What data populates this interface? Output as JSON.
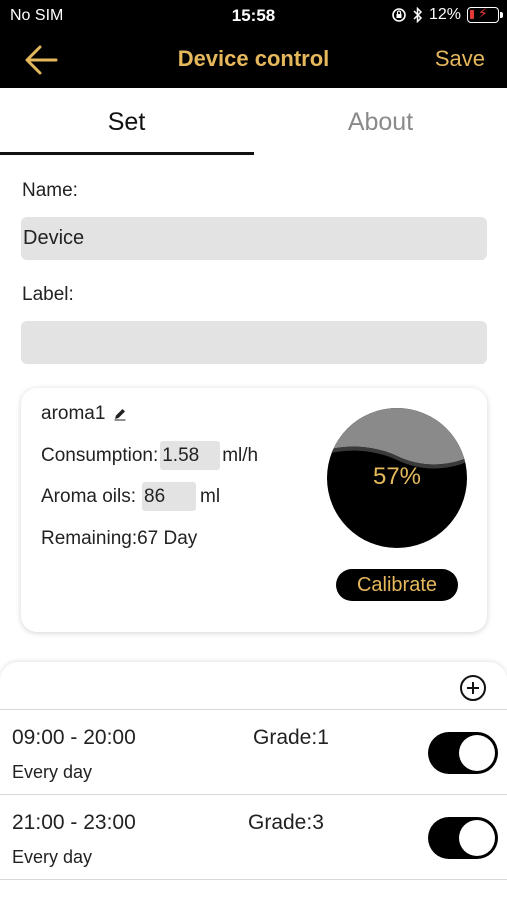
{
  "status_bar": {
    "carrier": "No SIM",
    "time": "15:58",
    "battery": "12%"
  },
  "nav": {
    "title": "Device control",
    "save_label": "Save",
    "back_icon": "arrow-left-icon"
  },
  "tabs": [
    {
      "label": "Set",
      "active": true
    },
    {
      "label": "About",
      "active": false
    }
  ],
  "form": {
    "name_label": "Name:",
    "name_value": "Device",
    "label_label": "Label:",
    "label_value": ""
  },
  "aroma": {
    "name": "aroma1",
    "consumption_label": "Consumption:",
    "consumption_value": "1.58",
    "consumption_unit": "ml/h",
    "oils_label": "Aroma oils:",
    "oils_value": "86",
    "oils_unit": "ml",
    "remaining_text": "Remaining:67 Day",
    "level_percent": "57%",
    "level_fraction": 0.57,
    "calibrate_label": "Calibrate"
  },
  "schedule": [
    {
      "time_range": "09:00 - 20:00",
      "repeat": "Every day",
      "grade": "Grade:1",
      "enabled": true
    },
    {
      "time_range": "21:00 - 23:00",
      "repeat": "Every day",
      "grade": "Grade:3",
      "enabled": true
    }
  ],
  "colors": {
    "accent": "#e6b85c",
    "bar_bg": "#000000",
    "input_bg": "#e3e3e3"
  }
}
